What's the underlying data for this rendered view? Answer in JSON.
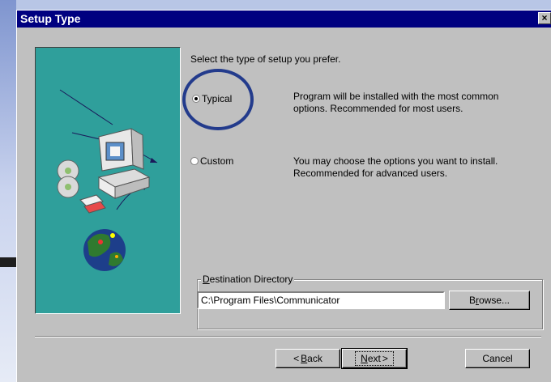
{
  "dialog": {
    "title": "Setup Type",
    "close_label": "×"
  },
  "prompt": "Select the type of setup you prefer.",
  "options": [
    {
      "label": "Typical",
      "selected": true,
      "description_line1": "Program will be installed with the most common",
      "description_line2": "options. Recommended for most users."
    },
    {
      "label": "Custom",
      "selected": false,
      "description_line1": "You may choose the options you want to install.",
      "description_line2": "Recommended for advanced users."
    }
  ],
  "destination": {
    "group_label_first": "D",
    "group_label_rest": "estination Directory",
    "path": "C:\\Program Files\\Communicator",
    "browse_pre": "B",
    "browse_u": "r",
    "browse_post": "owse..."
  },
  "buttons": {
    "back_arrow": "<",
    "back_u": "B",
    "back_rest": "ack",
    "next_u": "N",
    "next_rest": "ext",
    "next_arrow": ">",
    "cancel": "Cancel"
  },
  "colors": {
    "titlebar": "#000080",
    "dialog_bg": "#c0c0c0",
    "art_bg": "#2f9f9b",
    "highlight_ring": "#233b8c"
  },
  "icons": [
    "close-icon",
    "computer-icon",
    "cd-disc-icon",
    "globe-icon",
    "floppy-disk-icon"
  ]
}
